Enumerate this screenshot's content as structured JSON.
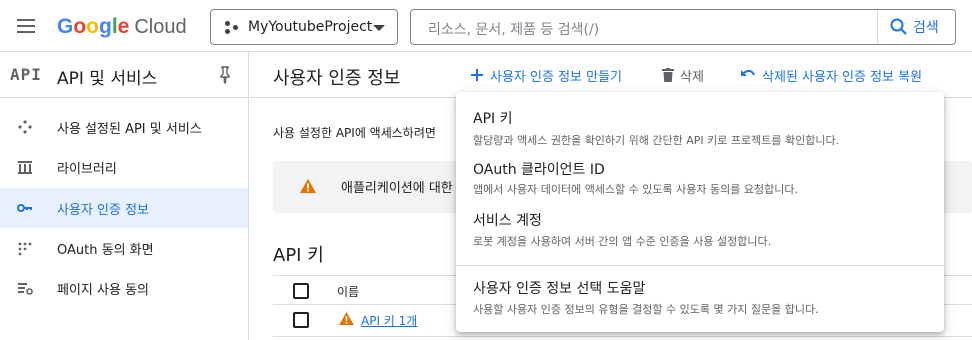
{
  "topbar": {
    "logo": {
      "google": "Google",
      "cloud": "Cloud"
    },
    "project": {
      "name": "MyYoutubeProject"
    },
    "search": {
      "placeholder": "리소스, 문서, 제품 등 검색(/)",
      "button_label": "검색"
    }
  },
  "sidebar": {
    "logo_text": "API",
    "title": "API 및 서비스",
    "items": [
      {
        "label": "사용 설정된 API 및 서비스",
        "icon": "diamond-dots-icon",
        "active": false
      },
      {
        "label": "라이브러리",
        "icon": "library-icon",
        "active": false
      },
      {
        "label": "사용자 인증 정보",
        "icon": "key-icon",
        "active": true
      },
      {
        "label": "OAuth 동의 화면",
        "icon": "oauth-dots-icon",
        "active": false
      },
      {
        "label": "페이지 사용 동의",
        "icon": "settings-list-icon",
        "active": false
      }
    ]
  },
  "main": {
    "title": "사용자 인증 정보",
    "toolbar": {
      "create_label": "사용자 인증 정보 만들기",
      "delete_label": "삭제",
      "restore_label": "삭제된 사용자 인증 정보 복원"
    },
    "description": "사용 설정한 API에 액세스하려면",
    "warning": "애플리케이션에 대한",
    "api_keys": {
      "title": "API 키",
      "column_name": "이름",
      "rows": [
        {
          "name": "API 키 1개"
        }
      ]
    }
  },
  "dropdown": {
    "items": [
      {
        "title": "API 키",
        "desc": "할당량과 액세스 권한을 확인하기 위해 간단한 API 키로 프로젝트를 확인합니다."
      },
      {
        "title": "OAuth 클라이언트 ID",
        "desc": "앱에서 사용자 데이터에 액세스할 수 있도록 사용자 동의를 요청합니다."
      },
      {
        "title": "서비스 계정",
        "desc": "로봇 계정을 사용하여 서버 간의 앱 수준 인증을 사용 설정합니다."
      },
      {
        "title": "사용자 인증 정보 선택 도움말",
        "desc": "사용할 사용자 인증 정보의 유형을 결정할 수 있도록 몇 가지 질문을 합니다."
      }
    ]
  },
  "colors": {
    "accent": "#1a73e8",
    "active_bg": "#e8f0fe",
    "warning": "#e37400"
  }
}
